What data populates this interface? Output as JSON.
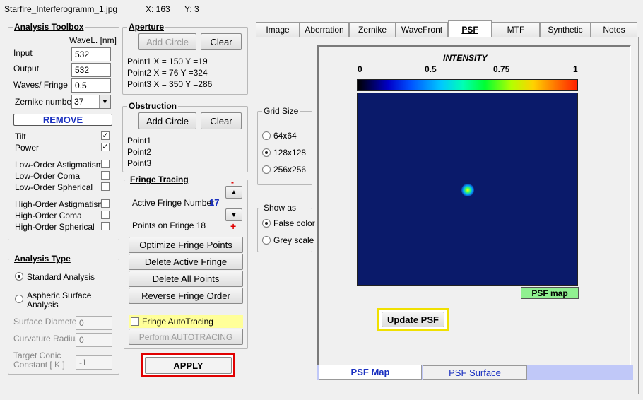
{
  "titlebar": {
    "filename": "Starfire_Interferogramm_1.jpg",
    "x": "X: 163",
    "y": "Y: 3"
  },
  "analysis_toolbox": {
    "title": "Analysis Toolbox",
    "wavel_header": "WaveL. [nm]",
    "input_label": "Input",
    "input_value": "532",
    "output_label": "Output",
    "output_value": "532",
    "waves_label": "Waves/ Fringe",
    "waves_value": "0.5",
    "zernike_label": "Zernike number",
    "zernike_value": "37",
    "remove_label": "REMOVE",
    "terms": [
      {
        "label": "Tilt",
        "checked": true
      },
      {
        "label": "Power",
        "checked": true
      },
      {
        "label": "Low-Order  Astigmatism",
        "checked": false
      },
      {
        "label": "Low-Order  Coma",
        "checked": false
      },
      {
        "label": "Low-Order  Spherical",
        "checked": false
      },
      {
        "label": "High-Order  Astigmatism",
        "checked": false
      },
      {
        "label": "High-Order  Coma",
        "checked": false
      },
      {
        "label": "High-Order  Spherical",
        "checked": false
      }
    ]
  },
  "analysis_type": {
    "title": "Analysis Type",
    "standard_label": "Standard Analysis",
    "aspheric_line1": "Aspheric  Surface",
    "aspheric_line2": "Analysis",
    "surface_diameter_label": "Surface Diameter",
    "surface_diameter_value": "0",
    "curvature_radius_label": "Curvature Radius",
    "curvature_radius_value": "0",
    "target_conic_line1": "Target Conic",
    "target_conic_line2": "Constant [ K ]",
    "target_conic_value": "-1"
  },
  "aperture": {
    "title": "Aperture",
    "add_label": "Add Circle",
    "clear_label": "Clear",
    "point1": "Point1 X =   150   Y =19",
    "point2": "Point2 X =   76   Y =324",
    "point3": "Point3 X =   350   Y =286"
  },
  "obstruction": {
    "title": "Obstruction",
    "add_label": "Add Circle",
    "clear_label": "Clear",
    "point1": "Point1",
    "point2": "Point2",
    "point3": "Point3"
  },
  "fringe_tracing": {
    "title": "Fringe Tracing",
    "active_label": "Active Fringe Number",
    "active_value": "17",
    "minus": "-",
    "plus": "+",
    "points_label": "Points on  Fringe 18",
    "optimize_label": "Optimize Fringe Points",
    "delete_active_label": "Delete Active Fringe",
    "delete_all_label": "Delete  All  Points",
    "reverse_label": "Reverse  Fringe Order",
    "autotracing_label": "Fringe AutoTracing",
    "perform_label": "Perform  AUTOTRACING"
  },
  "apply_label": "APPLY",
  "tabs": [
    "Image",
    "Aberration",
    "Zernike",
    "WaveFront",
    "PSF",
    "MTF",
    "Synthetic",
    "Notes"
  ],
  "active_tab": "PSF",
  "grid_size": {
    "title": "Grid Size",
    "options": [
      "64x64",
      "128x128",
      "256x256"
    ],
    "selected": "128x128"
  },
  "show_as": {
    "title": "Show as",
    "options": [
      "False color",
      "Grey scale"
    ],
    "selected": "False color"
  },
  "psf_panel": {
    "intensity_title": "INTENSITY",
    "scale_labels": [
      "0",
      "0.5",
      "0.75",
      "1"
    ],
    "psf_map_badge": "PSF map",
    "update_label": "Update PSF",
    "bottom_tabs": [
      "PSF  Map",
      "PSF Surface"
    ],
    "colors": {
      "map_bg": "#0a1a6a",
      "badge_bg": "#90f090"
    }
  }
}
